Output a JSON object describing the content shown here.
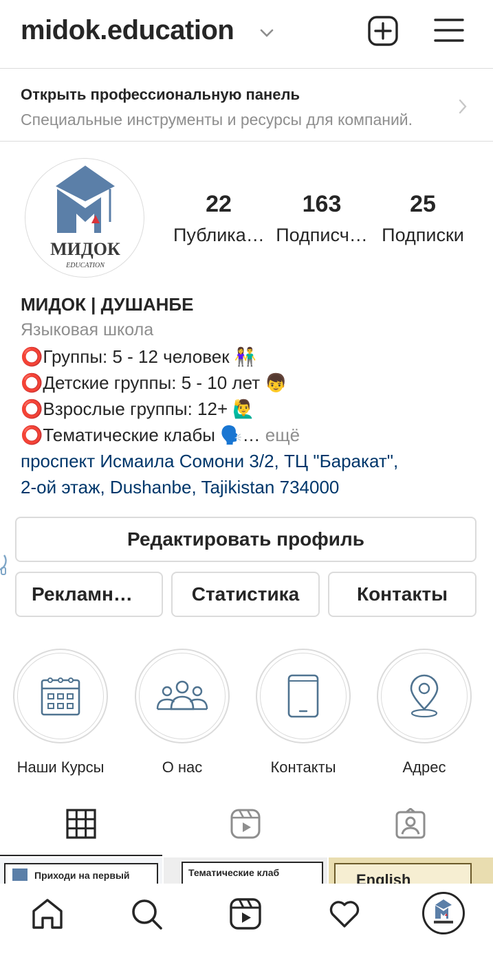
{
  "header": {
    "username": "midok.education",
    "icons": [
      "chevron-down-icon",
      "add-icon",
      "menu-icon"
    ]
  },
  "pro_panel": {
    "title": "Открыть профессиональную панель",
    "subtitle": "Специальные инструменты и ресурсы для компаний."
  },
  "avatar": {
    "logo_text": "МИДОК",
    "logo_sub": "EDUCATION"
  },
  "stats": [
    {
      "value": "22",
      "label": "Публика…"
    },
    {
      "value": "163",
      "label": "Подписч…"
    },
    {
      "value": "25",
      "label": "Подписки"
    }
  ],
  "bio": {
    "name": "МИДОК | ДУШАНБЕ",
    "category": "Языковая школа",
    "lines": [
      "⭕Группы: 5 - 12 человек 👫",
      "⭕Детские группы: 5 - 10 лет 👦",
      "⭕Взрослые группы: 12+ 🙋‍♂️",
      "⭕Тематические клабы 🗣️…"
    ],
    "more": " ещё",
    "address_line1": "проспект Исмаила Сомони 3/2, ТЦ \"Баракат\",",
    "address_line2": "2-ой этаж, Dushanbe, Tajikistan 734000"
  },
  "buttons": {
    "edit_profile": "Редактировать профиль",
    "ads": "Рекламн…",
    "statistics": "Статистика",
    "contacts": "Контакты"
  },
  "highlights": [
    {
      "label": "Наши Курсы",
      "icon": "calendar-icon"
    },
    {
      "label": "О нас",
      "icon": "people-icon"
    },
    {
      "label": "Контакты",
      "icon": "phone-icon"
    },
    {
      "label": "Адрес",
      "icon": "location-pin-icon"
    }
  ],
  "tabs": [
    "grid-icon",
    "reels-icon",
    "tagged-icon"
  ],
  "grid_previews": [
    "Приходи на первый",
    "Тематические клаб",
    "English"
  ],
  "bottom_nav": [
    "home-icon",
    "search-icon",
    "reels-icon",
    "heart-icon",
    "profile-avatar"
  ],
  "colors": {
    "text": "#262626",
    "secondary": "#8e8e8e",
    "link": "#00376b",
    "border": "#dbdbdb",
    "icon_blue": "#4f7390",
    "logo_blue": "#5b7fa8",
    "logo_red": "#d9343a"
  }
}
